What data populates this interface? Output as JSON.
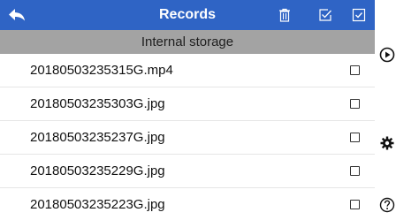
{
  "header": {
    "title": "Records",
    "back_icon": "back-arrow-icon",
    "delete_icon": "trash-icon",
    "select_icon": "check-list-icon",
    "select_all_icon": "checkbox-checked-icon",
    "bar_color": "#2f64c5"
  },
  "storage": {
    "label": "Internal storage",
    "bar_color": "#a3a3a3"
  },
  "files": [
    {
      "name": "20180503235315G.mp4",
      "checked": false
    },
    {
      "name": "20180503235303G.jpg",
      "checked": false
    },
    {
      "name": "20180503235237G.jpg",
      "checked": false
    },
    {
      "name": "20180503235229G.jpg",
      "checked": false
    },
    {
      "name": "20180503235223G.jpg",
      "checked": false
    }
  ],
  "side_controls": {
    "play_icon": "play-circle-icon",
    "settings_icon": "gear-icon",
    "help_icon": "help-circle-icon"
  }
}
